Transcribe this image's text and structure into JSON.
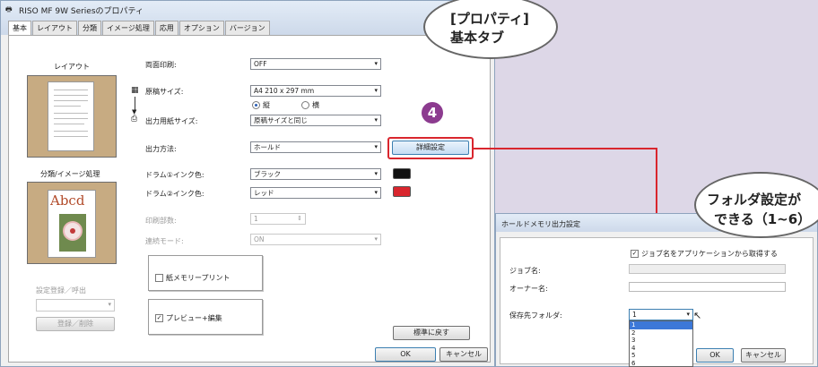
{
  "window": {
    "title": "RISO MF 9W Seriesのプロパティ",
    "tabs": [
      "基本",
      "レイアウト",
      "分類",
      "イメージ処理",
      "応用",
      "オプション",
      "バージョン"
    ]
  },
  "left": {
    "layout_label": "レイアウト",
    "sort_label": "分類/イメージ処理",
    "sample_text": "Abcd",
    "preset_label": "設定登録／呼出",
    "preset_button": "登録／削除"
  },
  "form": {
    "duplex_label": "両面印刷:",
    "duplex_value": "OFF",
    "original_size_label": "原稿サイズ:",
    "original_size_value": "A4 210 x 297 mm",
    "orient_portrait": "縦",
    "orient_landscape": "横",
    "output_size_label": "出力用紙サイズ:",
    "output_size_value": "原稿サイズと同じ",
    "output_method_label": "出力方法:",
    "output_method_value": "ホールド",
    "detail_button": "詳細設定",
    "drum1_label": "ドラム①インク色:",
    "drum1_value": "ブラック",
    "drum2_label": "ドラム②インク色:",
    "drum2_value": "レッド",
    "copies_label": "印刷部数:",
    "copies_value": "1",
    "output_mode_label": "連続モード:",
    "output_mode_value": "ON",
    "paper_memory_label": "紙メモリープリント",
    "preview_label": "プレビュー+編集",
    "default_button": "標準に戻す",
    "ok_button": "OK",
    "cancel_button": "キャンセル"
  },
  "step_number": "4",
  "callout_top": {
    "line1": "[プロパティ]",
    "line2": "基本タブ"
  },
  "callout_right": {
    "line1": "フォルダ設定が",
    "line2": "できる（1~6）"
  },
  "hold_dialog": {
    "title": "ホールドメモリ出力設定",
    "use_app_job_name": "ジョブ名をアプリケーションから取得する",
    "job_name_label": "ジョブ名:",
    "owner_label": "オーナー名:",
    "folder_label": "保存先フォルダ:",
    "folder_value": "1",
    "folder_options": [
      "1",
      "2",
      "3",
      "4",
      "5",
      "6"
    ],
    "ok_button": "OK",
    "cancel_button": "キャンセル"
  },
  "colors": {
    "accent_red": "#d9262e",
    "drum1_color": "#111111",
    "drum2_color": "#d9262e",
    "step_circle": "#8c3b8f"
  }
}
